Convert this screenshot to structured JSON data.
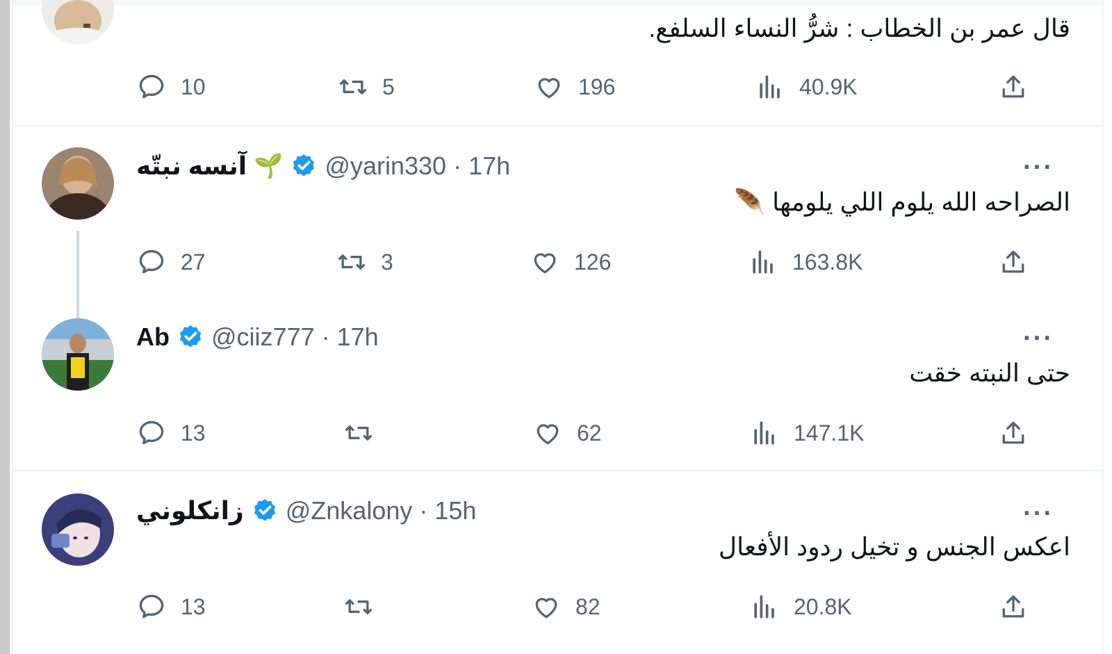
{
  "tweets": [
    {
      "text": "قال عمر بن الخطاب : شرُّ النساء السلفع.",
      "replies": "10",
      "retweets": "5",
      "likes": "196",
      "views": "40.9K"
    },
    {
      "name": "آنسه نبتّه",
      "name_emoji": "🌱",
      "handle": "@yarin330",
      "time": "· 17h",
      "text": "الصراحه الله يلوم اللي يلومها",
      "text_emoji": "🪶",
      "more": "···",
      "replies": "27",
      "retweets": "3",
      "likes": "126",
      "views": "163.8K"
    },
    {
      "name": "Ab",
      "handle": "@ciiz777",
      "time": "· 17h",
      "text": "حتى النبته خقت",
      "more": "···",
      "replies": "13",
      "retweets": "",
      "likes": "62",
      "views": "147.1K"
    },
    {
      "name": "زانكلوني",
      "handle": "@Znkalony",
      "time": "· 15h",
      "text": "اعكس الجنس و تخيل ردود الأفعال",
      "more": "···",
      "replies": "13",
      "retweets": "",
      "likes": "82",
      "views": "20.8K"
    }
  ],
  "colors": {
    "verified": "#1d9bf0",
    "muted": "#536471",
    "text": "#0f1419",
    "border": "#eff3f4"
  },
  "icons": [
    "reply-icon",
    "retweet-icon",
    "like-icon",
    "views-icon",
    "share-icon",
    "verified-badge-icon",
    "more-icon"
  ]
}
